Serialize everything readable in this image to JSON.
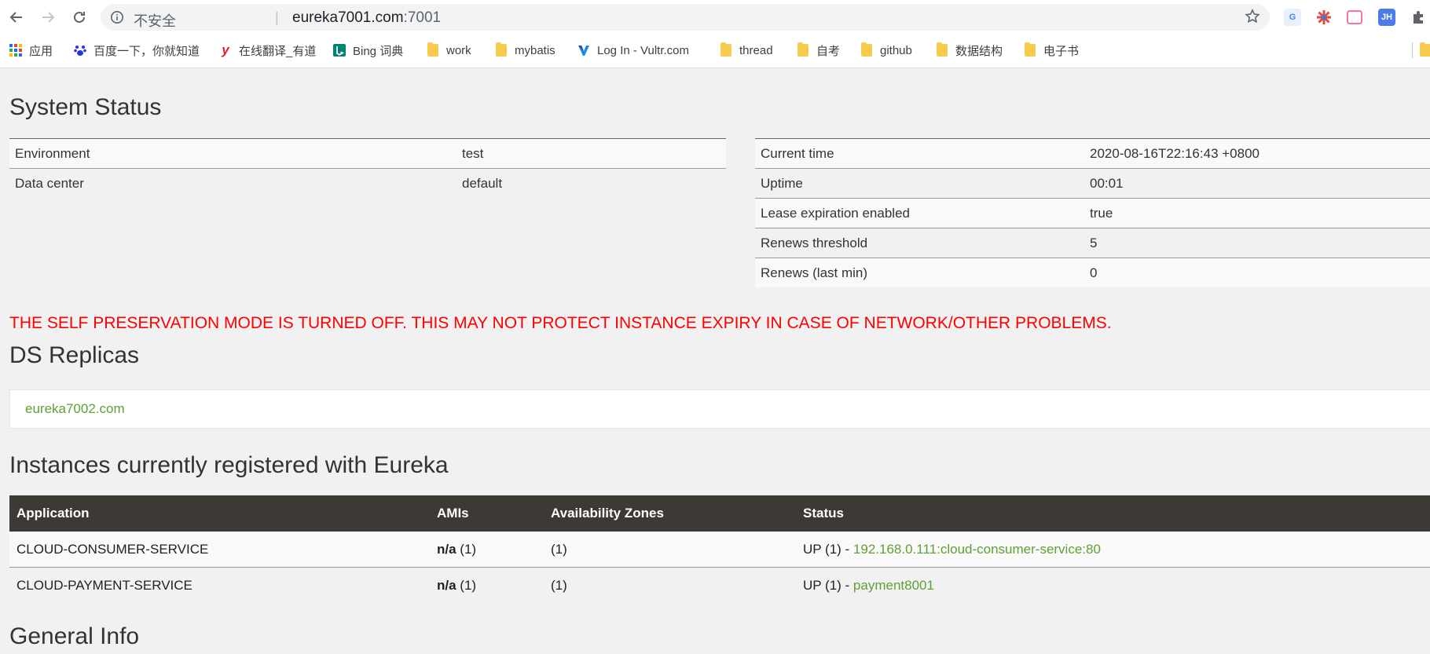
{
  "browser": {
    "omnibox": {
      "security_label": "不安全",
      "separator": "|",
      "host": "eureka7001.com",
      "port": ":7001"
    },
    "extensions": [
      {
        "name": "translate-extension",
        "label": "G",
        "color": "#4285f4"
      },
      {
        "name": "pinwheel-extension",
        "label": "✻",
        "color": "#ffffff"
      },
      {
        "name": "bilibili-extension",
        "label": "",
        "color": "#fb7299"
      },
      {
        "name": "jh-extension",
        "label": "JH",
        "color": "#4c7be8"
      }
    ],
    "bookmarks": [
      {
        "label": "应用"
      },
      {
        "label": "百度一下，你就知道"
      },
      {
        "label": "在线翻译_有道"
      },
      {
        "label": "Bing 词典"
      },
      {
        "label": "work"
      },
      {
        "label": "mybatis"
      },
      {
        "label": "Log In - Vultr.com"
      },
      {
        "label": "thread"
      },
      {
        "label": "自考"
      },
      {
        "label": "github"
      },
      {
        "label": "数据结构"
      },
      {
        "label": "电子书"
      }
    ]
  },
  "page": {
    "system_status": {
      "title": "System Status",
      "left": [
        {
          "label": "Environment",
          "value": "test"
        },
        {
          "label": "Data center",
          "value": "default"
        }
      ],
      "right": [
        {
          "label": "Current time",
          "value": "2020-08-16T22:16:43 +0800"
        },
        {
          "label": "Uptime",
          "value": "00:01"
        },
        {
          "label": "Lease expiration enabled",
          "value": "true"
        },
        {
          "label": "Renews threshold",
          "value": "5"
        },
        {
          "label": "Renews (last min)",
          "value": "0"
        }
      ]
    },
    "warning": "THE SELF PRESERVATION MODE IS TURNED OFF. THIS MAY NOT PROTECT INSTANCE EXPIRY IN CASE OF NETWORK/OTHER PROBLEMS.",
    "ds_replicas": {
      "title": "DS Replicas",
      "items": [
        "eureka7002.com"
      ]
    },
    "instances": {
      "title": "Instances currently registered with Eureka",
      "headers": [
        "Application",
        "AMIs",
        "Availability Zones",
        "Status"
      ],
      "rows": [
        {
          "application": "CLOUD-CONSUMER-SERVICE",
          "ami": "n/a",
          "ami_count": " (1)",
          "zones": "(1)",
          "status_prefix": "UP (1) - ",
          "instance_link": "192.168.0.111:cloud-consumer-service:80"
        },
        {
          "application": "CLOUD-PAYMENT-SERVICE",
          "ami": "n/a",
          "ami_count": " (1)",
          "zones": "(1)",
          "status_prefix": "UP (1) - ",
          "instance_link": "payment8001"
        }
      ]
    },
    "general_info": {
      "title": "General Info"
    }
  },
  "colors": {
    "link_green": "#5fa134",
    "warning_red": "#ff0000",
    "table_header": "#3d3934",
    "page_bg": "#f1f1f1"
  }
}
